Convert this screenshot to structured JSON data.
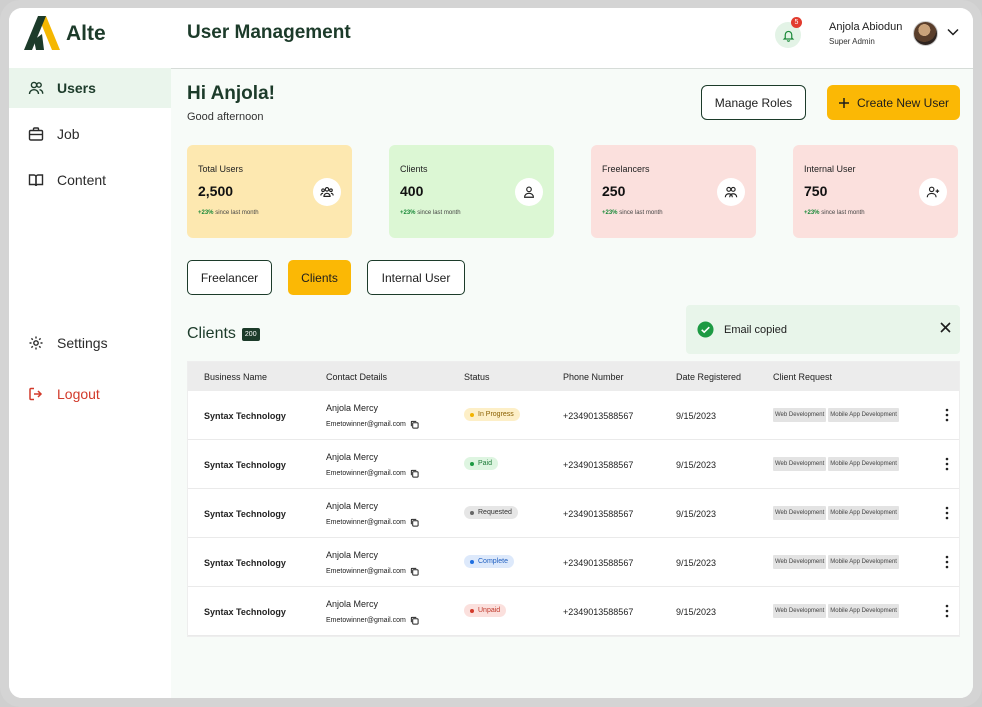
{
  "brand": {
    "name": "Alte",
    "accent": "#fbb805",
    "primary": "#1c3b2a"
  },
  "sidebar": {
    "items": [
      {
        "label": "Users",
        "icon": "users-icon",
        "active": true
      },
      {
        "label": "Job",
        "icon": "briefcase-icon",
        "active": false
      },
      {
        "label": "Content",
        "icon": "book-icon",
        "active": false
      }
    ],
    "settings_label": "Settings",
    "logout_label": "Logout"
  },
  "header": {
    "title": "User Management",
    "notification_count": "5",
    "user_name": "Anjola Abiodun",
    "user_role": "Super Admin"
  },
  "main": {
    "greeting": "Hi Anjola!",
    "greeting_sub": "Good afternoon",
    "manage_roles_label": "Manage Roles",
    "create_user_label": "Create New User",
    "stats": [
      {
        "title": "Total Users",
        "value": "2,500",
        "trend": "+23%",
        "trend_text": "since last month",
        "color": "#fde8b0"
      },
      {
        "title": "Clients",
        "value": "400",
        "trend": "+23%",
        "trend_text": "since last month",
        "color": "#dcf7d4"
      },
      {
        "title": "Freelancers",
        "value": "250",
        "trend": "+23%",
        "trend_text": "since last month",
        "color": "#fbe0dd"
      },
      {
        "title": "Internal User",
        "value": "750",
        "trend": "+23%",
        "trend_text": "since last month",
        "color": "#fbe0dd"
      }
    ],
    "tabs": [
      {
        "label": "Freelancer",
        "active": false
      },
      {
        "label": "Clients",
        "active": true
      },
      {
        "label": "Internal User",
        "active": false
      }
    ],
    "section_title": "Clients",
    "section_count": "200",
    "toast": {
      "message": "Email copied"
    },
    "table": {
      "headers": [
        "Business Name",
        "Contact Details",
        "Status",
        "Phone Number",
        "Date Registered",
        "Client Request"
      ],
      "rows": [
        {
          "business": "Syntax Technology",
          "name": "Anjola Mercy",
          "email": "Emetowinner@gmail.com",
          "status": "In Progress",
          "phone": "+2349013588567",
          "date": "9/15/2023",
          "req1": "Web Development",
          "req2": "Mobile App Development"
        },
        {
          "business": "Syntax Technology",
          "name": "Anjola Mercy",
          "email": "Emetowinner@gmail.com",
          "status": "Paid",
          "phone": "+2349013588567",
          "date": "9/15/2023",
          "req1": "Web Development",
          "req2": "Mobile App Development"
        },
        {
          "business": "Syntax Technology",
          "name": "Anjola Mercy",
          "email": "Emetowinner@gmail.com",
          "status": "Requested",
          "phone": "+2349013588567",
          "date": "9/15/2023",
          "req1": "Web Development",
          "req2": "Mobile App Development"
        },
        {
          "business": "Syntax Technology",
          "name": "Anjola Mercy",
          "email": "Emetowinner@gmail.com",
          "status": "Complete",
          "phone": "+2349013588567",
          "date": "9/15/2023",
          "req1": "Web Development",
          "req2": "Mobile App Development"
        },
        {
          "business": "Syntax Technology",
          "name": "Anjola Mercy",
          "email": "Emetowinner@gmail.com",
          "status": "Unpaid",
          "phone": "+2349013588567",
          "date": "9/15/2023",
          "req1": "Web Development",
          "req2": "Mobile App Development"
        }
      ]
    },
    "status_colors": {
      "In Progress": {
        "bg": "#fdefc7",
        "dot": "#f2b300",
        "text": "#8a6000"
      },
      "Paid": {
        "bg": "#def5e1",
        "dot": "#1d9a43",
        "text": "#1d7a38"
      },
      "Requested": {
        "bg": "#e6e6e6",
        "dot": "#666666",
        "text": "#333333"
      },
      "Complete": {
        "bg": "#dde9fb",
        "dot": "#1f6fe0",
        "text": "#1f5fc0"
      },
      "Unpaid": {
        "bg": "#fbe0dd",
        "dot": "#d23a2b",
        "text": "#c0392b"
      }
    }
  }
}
